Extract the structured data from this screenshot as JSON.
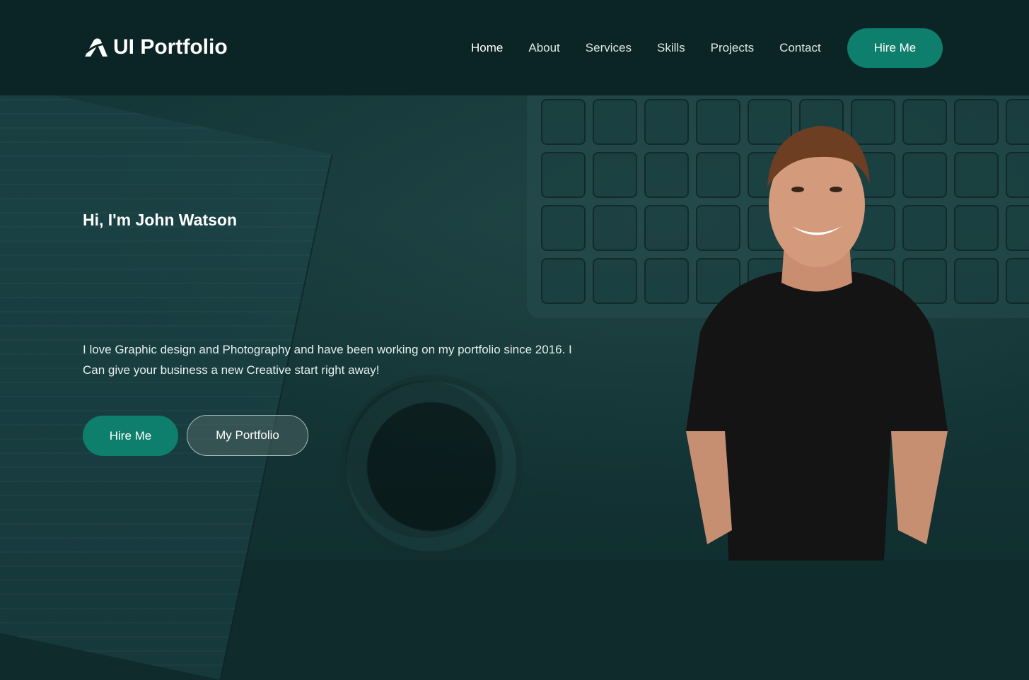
{
  "brand": {
    "name": "UI Portfolio",
    "icon": "logo-mark-icon"
  },
  "nav": {
    "items": [
      {
        "label": "Home"
      },
      {
        "label": "About"
      },
      {
        "label": "Services"
      },
      {
        "label": "Skills"
      },
      {
        "label": "Projects"
      },
      {
        "label": "Contact"
      }
    ],
    "cta": "Hire Me"
  },
  "hero": {
    "title": "Hi, I'm John Watson",
    "description": "I love Graphic design and Photography and have been working on my portfolio since 2016. I Can give your business a new Creative start right away!",
    "primary_button": "Hire Me",
    "secondary_button": "My Portfolio"
  },
  "colors": {
    "accent": "#0e7f6d",
    "header_bg": "#0b2425",
    "page_bg": "#133536"
  }
}
